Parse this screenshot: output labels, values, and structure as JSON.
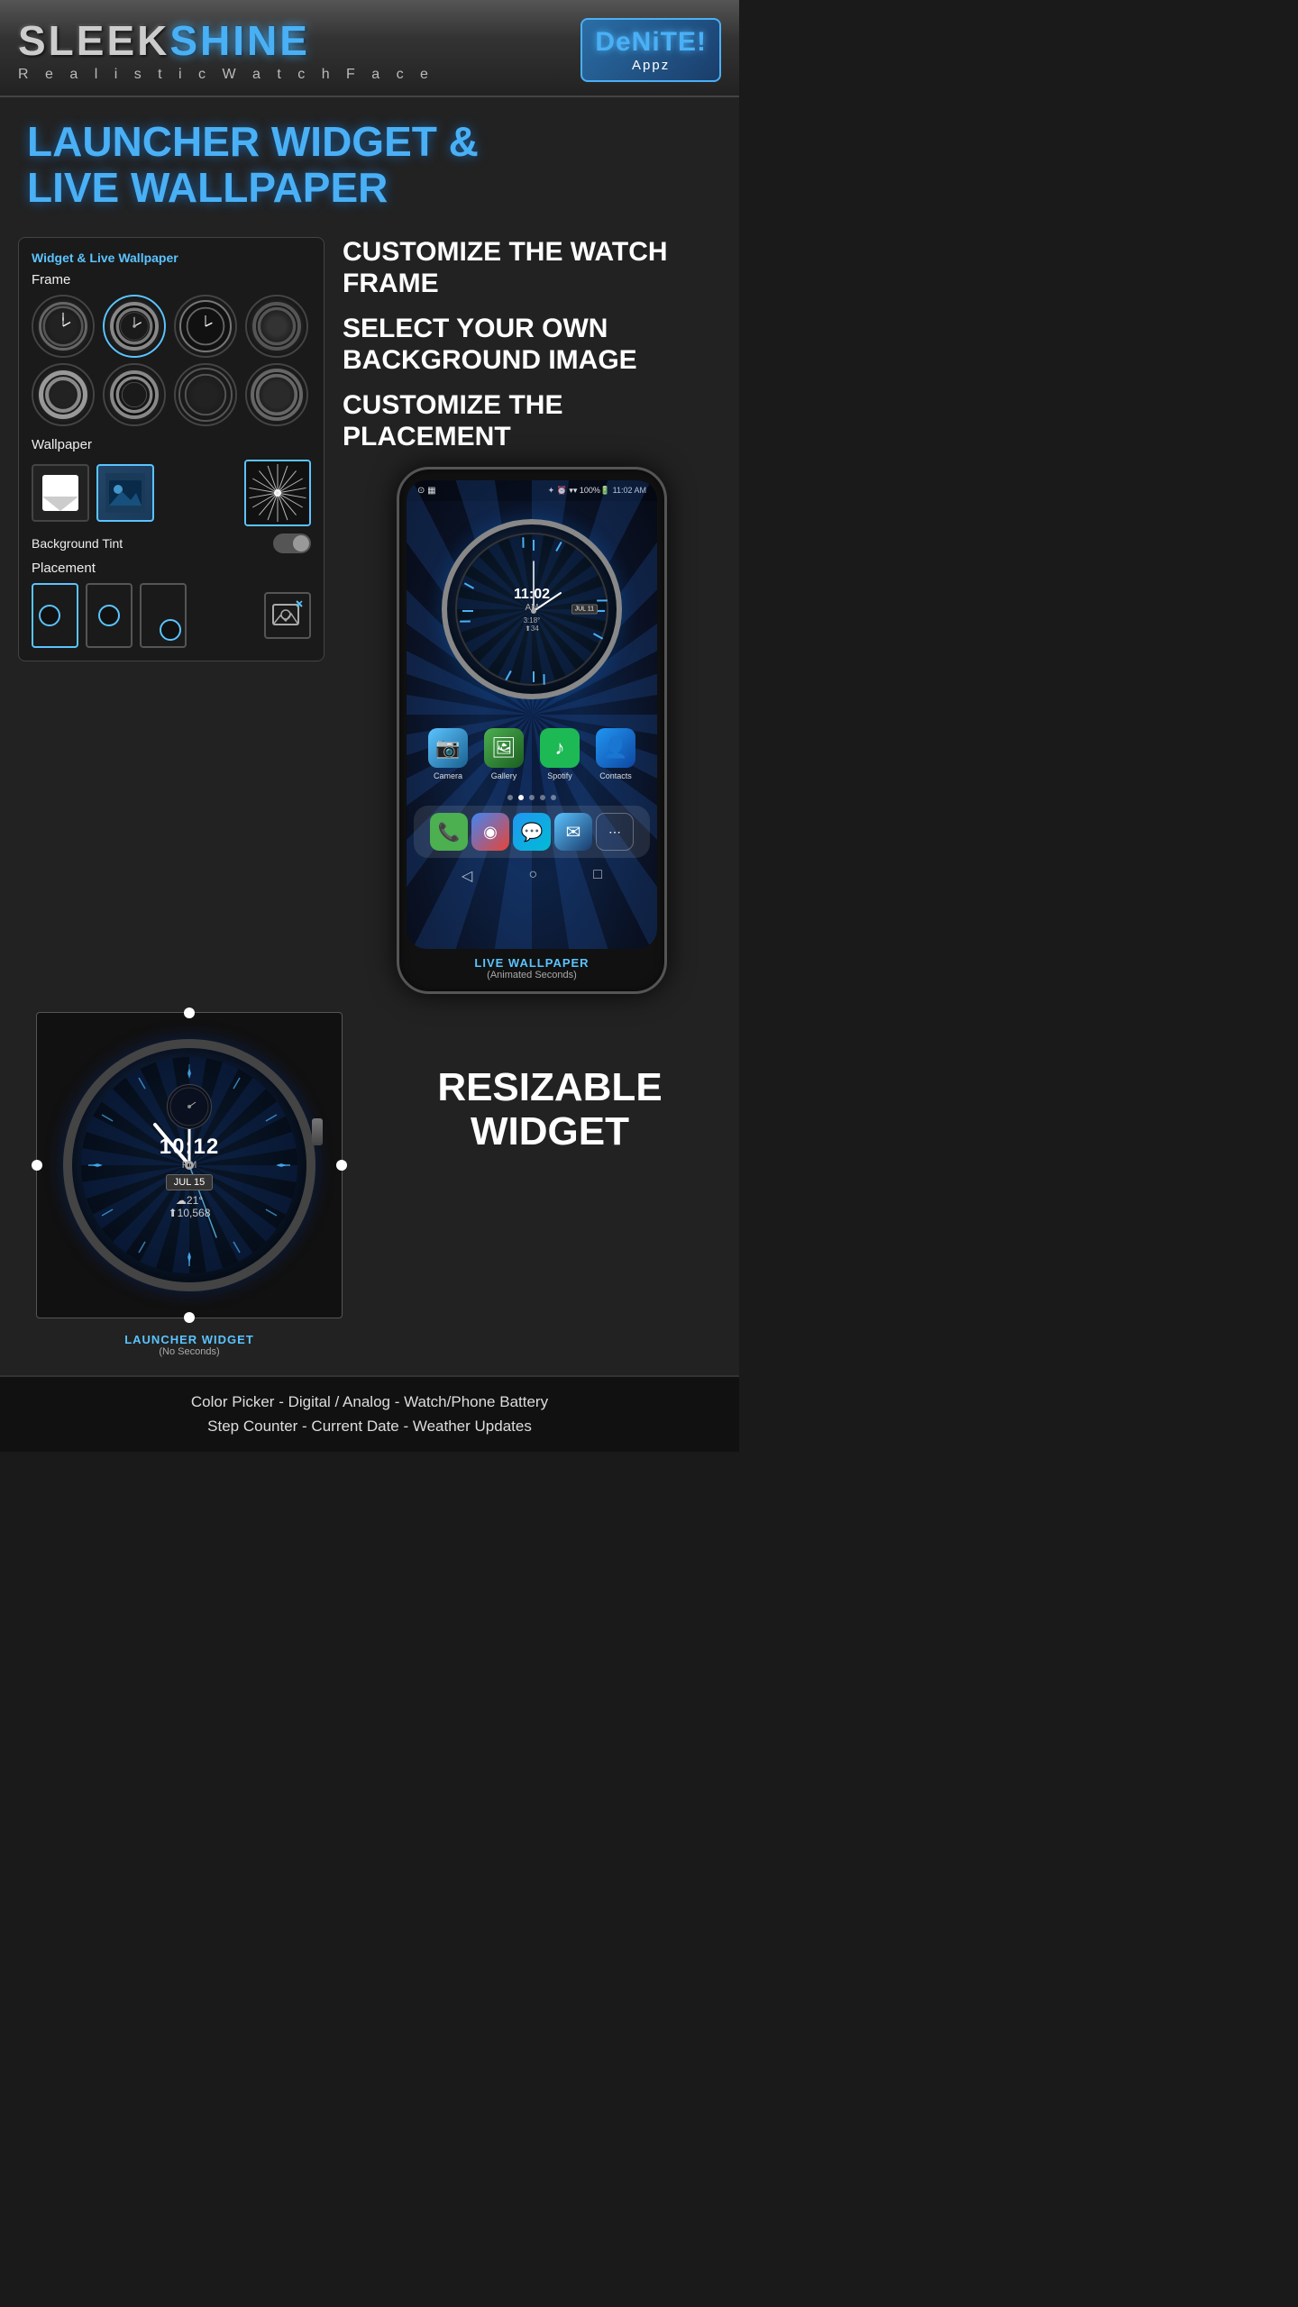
{
  "header": {
    "title_sleek": "SLEEK ",
    "title_shine": "SHINE",
    "subtitle": "R e a l i s t i c   W a t c h F a c e",
    "logo_line1": "DeNiTE!",
    "logo_line2": "Appz"
  },
  "title_section": {
    "line1": "LAUNCHER WIDGET &",
    "line2": "LIVE WALLPAPER"
  },
  "features": {
    "feature1": "CUSTOMIZE THE WATCH FRAME",
    "feature2": "SELECT YOUR OWN BACKGROUND IMAGE",
    "feature3": "CUSTOMIZE THE PLACEMENT"
  },
  "widget_panel": {
    "title": "Widget & Live Wallpaper",
    "frame_label": "Frame",
    "wallpaper_label": "Wallpaper",
    "background_tint_label": "Background Tint",
    "placement_label": "Placement"
  },
  "widget_bottom": {
    "launcher_label": "LAUNCHER WIDGET",
    "launcher_sub": "(No Seconds)",
    "resizable_label": "RESIZABLE\nWIDGET"
  },
  "phone": {
    "status_left": "⊙ ▦",
    "status_right": "✦ ⏰ ▾ ▾ ▾  100%🔋  11:02 AM",
    "watch_time": "11:02",
    "watch_ampm": "AM",
    "watch_date": "JUL 11",
    "watch_temp": "3:18°",
    "watch_steps": "⬆34",
    "label_main": "LIVE WALLPAPER",
    "label_sub": "(Animated Seconds)"
  },
  "apps": [
    {
      "label": "Camera",
      "icon": "📷",
      "class": "app-camera"
    },
    {
      "label": "Gallery",
      "icon": "🖼",
      "class": "app-gallery"
    },
    {
      "label": "Spotify",
      "icon": "♪",
      "class": "app-spotify"
    },
    {
      "label": "Contacts",
      "icon": "👤",
      "class": "app-contacts"
    }
  ],
  "dock": [
    {
      "icon": "📞",
      "class": "dock-phone"
    },
    {
      "icon": "◉",
      "class": "dock-chrome"
    },
    {
      "icon": "💬",
      "class": "dock-msg"
    },
    {
      "icon": "✉",
      "class": "dock-mail"
    },
    {
      "icon": "⋯",
      "class": "dock-apps"
    }
  ],
  "widget_watch": {
    "time": "10:12",
    "ampm": "PM",
    "date": "JUL 15",
    "weather": "☁21°",
    "steps": "⬆10,568"
  },
  "footer": {
    "line1": "Color Picker - Digital / Analog - Watch/Phone Battery",
    "line2": "Step Counter - Current Date - Weather Updates"
  }
}
